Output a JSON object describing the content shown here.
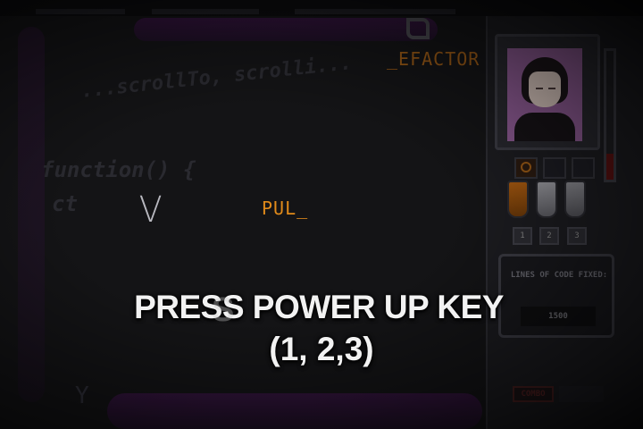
{
  "game": {
    "overlay_line1": "PRESS POWER UP KEY",
    "overlay_line2": "(1, 2,3)",
    "floating_letter": "V",
    "typed_word": "PUL_",
    "refactor_word": "_EFACTOR",
    "background_code": [
      "...scrollTo, scrolli...",
      "function() {",
      "ct"
    ]
  },
  "hud": {
    "powerup_keys": [
      "1",
      "2",
      "3"
    ],
    "lines_label": "LINES OF CODE FIXED:",
    "lines_value": "1500",
    "combo_label": "COMBO",
    "health_fraction": 0.2
  },
  "colors": {
    "accent_orange": "#e08a1a",
    "overlay_text": "#f2f2f2",
    "cable_purple": "#3a1446",
    "panel_bg": "#1c1c20"
  }
}
